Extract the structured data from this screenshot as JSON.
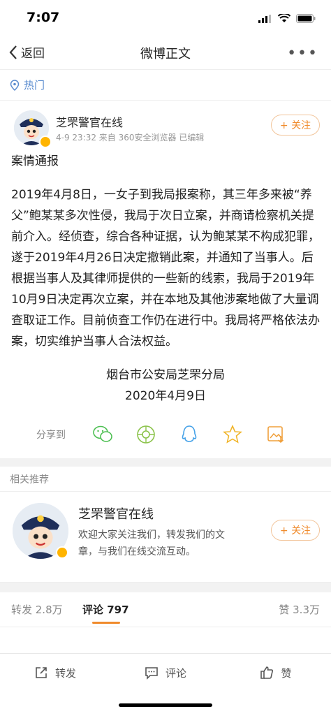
{
  "status": {
    "time": "7:07"
  },
  "nav": {
    "back_label": "返回",
    "title": "微博正文",
    "more": "•••"
  },
  "hot": {
    "label": "热门"
  },
  "post": {
    "author": "芝罘警官在线",
    "meta": "4-9 23:32  来自 360安全浏览器  已编辑",
    "follow_label": "+ 关注",
    "title_line": "案情通报",
    "body": "2019年4月8日，一女子到我局报案称，其三年多来被“养父”鲍某某多次性侵，我局于次日立案，并商请检察机关提前介入。经侦查，综合各种证据，认为鲍某某不构成犯罪，遂于2019年4月26日决定撤销此案，并通知了当事人。后根据当事人及其律师提供的一些新的线索，我局于2019年10月9日决定再次立案，并在本地及其他涉案地做了大量调查取证工作。目前侦查工作仍在进行中。我局将严格依法办案，切实维护当事人合法权益。",
    "sign_org": "烟台市公安局芝罘分局",
    "sign_date": "2020年4月9日",
    "share_label": "分享到"
  },
  "related": {
    "section_title": "相关推荐",
    "name": "芝罘警官在线",
    "desc": "欢迎大家关注我们，转发我们的文章，与我们在线交流互动。",
    "follow_label": "+ 关注"
  },
  "stats": {
    "repost": "转发 2.8万",
    "comment": "评论 797",
    "like": "赞 3.3万"
  },
  "actions": {
    "repost": "转发",
    "comment": "评论",
    "like": "赞"
  },
  "colors": {
    "accent": "#f08b2c",
    "link": "#5b8ccf"
  }
}
